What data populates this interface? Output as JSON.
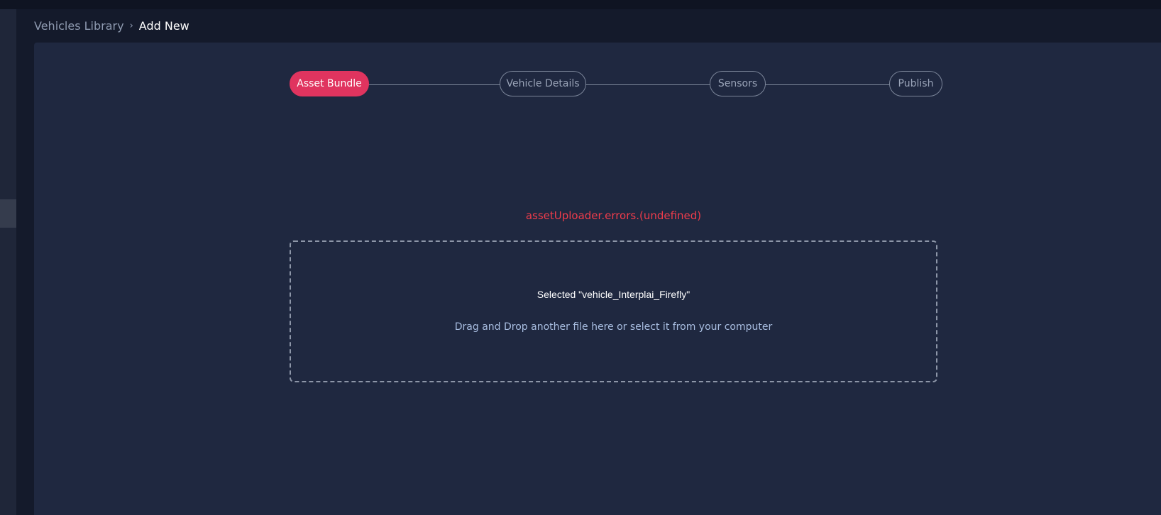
{
  "breadcrumb": {
    "parent": "Vehicles Library",
    "separator": "›",
    "current": "Add New"
  },
  "stepper": {
    "steps": [
      {
        "label": "Asset Bundle",
        "active": true
      },
      {
        "label": "Vehicle Details",
        "active": false
      },
      {
        "label": "Sensors",
        "active": false
      },
      {
        "label": "Publish",
        "active": false
      }
    ]
  },
  "uploader": {
    "error": "assetUploader.errors.(undefined)",
    "selected": "Selected \"vehicle_Interplai_Firefly\"",
    "hint": "Drag and Drop another file here or select it from your computer"
  },
  "colors": {
    "accent": "#e0345f",
    "error": "#f03c4b",
    "panel": "#1f2840",
    "background": "#141a2b"
  }
}
